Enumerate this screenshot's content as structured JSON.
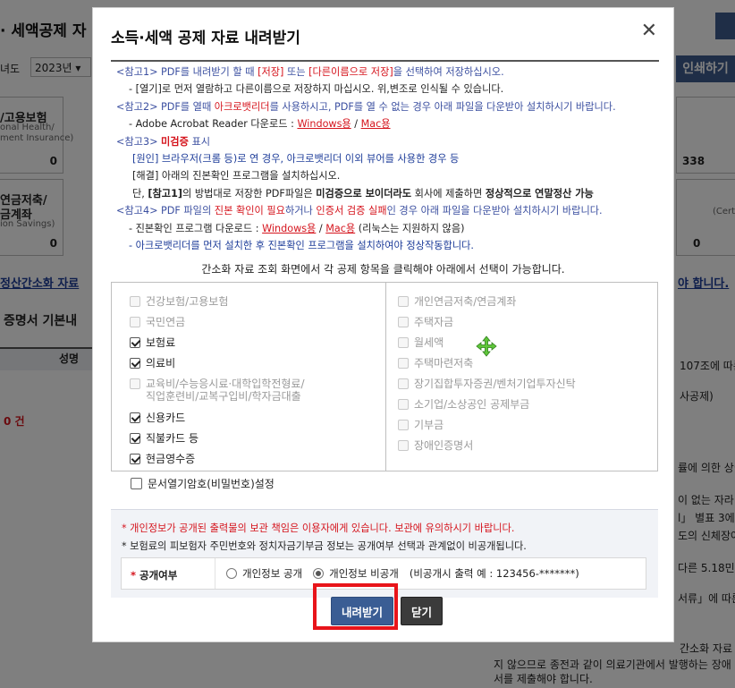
{
  "background": {
    "page_title": "· 세액공제 자",
    "year_label": "녀도",
    "year_select": "2023년",
    "print_button": "인쇄하기",
    "cards": [
      {
        "line1": "/고용보험",
        "line2": "onal Health/",
        "line3": "ment Insurance)",
        "value": "0"
      },
      {
        "line1": "연금저축/",
        "line2": "금계좌",
        "line3": "ion Savings)",
        "value": "0"
      }
    ],
    "right_value_1": "338",
    "right_value_2": "0",
    "right_sub": "(Certi",
    "simplified_link": "정산간소화 자료",
    "basic_heading": "증명서 기본내",
    "col_header": "성명",
    "count": "0 건",
    "right_link": "야 합니다.",
    "right_snips": [
      "107조에 따른",
      "사공제)",
      "률에 의한 상이",
      "이 없는 자라",
      "l」 별표 3에 -",
      "도의 신체장아",
      "다른 5.18민주",
      "서류」에 따른",
      "간소화 자료",
      "지 않으므로 종전과 같이 의료기관에서 발행하는 장애",
      "서를 제출해야 합니다."
    ]
  },
  "dialog": {
    "title": "소득·세액 공제 자료 내려받기",
    "close_icon": "close-icon",
    "notes": {
      "n1_lead": "<참고1>",
      "n1_a": " PDF를 내려받기 할 때 ",
      "n1_b": "[저장]",
      "n1_c": " 또는 ",
      "n1_d": "[다른이름으로 저장]",
      "n1_e": "을 선택하여 저장하십시오.",
      "n1_sub": "- [열기]로 먼저 열람하고 다른이름으로 저장하지 마십시오. 위,변조로 인식될 수 있습니다.",
      "n2_lead": "<참고2>",
      "n2_a": " PDF를 열때 ",
      "n2_b": "아크로뱃리더",
      "n2_c": "를 사용하시고, PDF를 열 수 없는 경우 아래 파일을 다운받아 설치하시기 바랍니다.",
      "n2_sub_a": "- Adobe Acrobat Reader 다운로드 : ",
      "n2_win": "Windows용",
      "n2_sep": " / ",
      "n2_mac": "Mac용",
      "n3_lead": "<참고3>",
      "n3_a": " ",
      "n3_b": "미검증",
      "n3_c": " 표시",
      "n3_cause": "[원인] 브라우저(크롬 등)로 연 경우, 아크로뱃리더 이외 뷰어를 사용한 경우 등",
      "n3_fix": "[해결] 아래의 진본확인 프로그램을 설치하십시오.",
      "n3_s1": "단, ",
      "n3_s2": "[참고1]",
      "n3_s3": "의 방법대로 저장한 PDF파일은 ",
      "n3_s4": "미검증으로 보이더라도",
      "n3_s5": " 회사에 제출하면 ",
      "n3_s6": "정상적으로 연말정산 가능",
      "n4_lead": "<참고4>",
      "n4_a": " PDF 파일의 ",
      "n4_b": "진본 확인이 필요",
      "n4_c": "하거나 ",
      "n4_d": "인증서 검증 실패",
      "n4_e": "인 경우 아래 파일을 다운받아 설치하시기 바랍니다.",
      "n4_sub_a": "- 진본확인 프로그램 다운로드 : ",
      "n4_win": "Windows용",
      "n4_sep": " / ",
      "n4_mac": "Mac용",
      "n4_tail": " (리눅스는 지원하지 않음)",
      "n4_sub2": "- 아크로뱃리더를 먼저 설치한 후 진본확인 프로그램을 설치하여야 정상작동합니다."
    },
    "guide": "간소화 자료 조회 화면에서 각 공제 항목을 클릭해야 아래에서 선택이 가능합니다.",
    "left_items": [
      {
        "label": "건강보험/고용보험",
        "checked": false,
        "enabled": false
      },
      {
        "label": "국민연금",
        "checked": false,
        "enabled": false
      },
      {
        "label": "보험료",
        "checked": true,
        "enabled": true
      },
      {
        "label": "의료비",
        "checked": true,
        "enabled": true
      },
      {
        "label": "교육비/수능응시료·대학입학전형료/",
        "label2": "직업훈련비/교복구입비/학자금대출",
        "checked": false,
        "enabled": false
      },
      {
        "label": "신용카드",
        "checked": true,
        "enabled": true
      },
      {
        "label": "직불카드 등",
        "checked": true,
        "enabled": true
      },
      {
        "label": "현금영수증",
        "checked": true,
        "enabled": true
      }
    ],
    "right_items": [
      {
        "label": "개인연금저축/연금계좌"
      },
      {
        "label": "주택자금"
      },
      {
        "label": "월세액"
      },
      {
        "label": "주택마련저축"
      },
      {
        "label": "장기집합투자증권/벤처기업투자신탁"
      },
      {
        "label": "소기업/소상공인 공제부금"
      },
      {
        "label": "기부금"
      },
      {
        "label": "장애인증명서"
      }
    ],
    "move_icon": "move-cursor-icon",
    "password_label": "문서열기암호(비밀번호)설정",
    "privacy": {
      "warn": "* 개인정보가 공개된 출력물의 보관 책임은 이용자에게 있습니다. 보관에 유의하시기 바랍니다.",
      "note": "* 보험료의 피보험자 주민번호와 정치자금기부금 정보는 공개여부 선택과 관계없이 비공개됩니다.",
      "row_star": "*",
      "row_label": "공개여부",
      "opt_public": "개인정보 공개",
      "opt_private": "개인정보 비공개",
      "opt_private_note": "(비공개시 출력 예 : 123456-*******)",
      "selected": "private"
    },
    "download_button": "내려받기",
    "close_button": "닫기",
    "highlight_color": "#e8141a"
  }
}
